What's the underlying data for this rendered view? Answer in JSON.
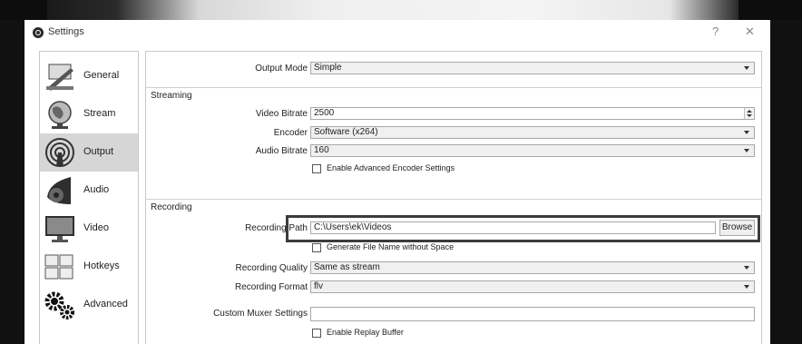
{
  "window": {
    "title": "Settings",
    "help_glyph": "?",
    "close_glyph": "✕"
  },
  "sidebar": {
    "items": [
      {
        "label": "General",
        "icon": "general-icon"
      },
      {
        "label": "Stream",
        "icon": "globe-icon"
      },
      {
        "label": "Output",
        "icon": "output-icon",
        "active": true
      },
      {
        "label": "Audio",
        "icon": "speaker-icon"
      },
      {
        "label": "Video",
        "icon": "monitor-icon"
      },
      {
        "label": "Hotkeys",
        "icon": "keyboard-icon"
      },
      {
        "label": "Advanced",
        "icon": "gears-icon"
      }
    ]
  },
  "output": {
    "output_mode_label": "Output Mode",
    "output_mode_value": "Simple",
    "streaming": {
      "title": "Streaming",
      "video_bitrate_label": "Video Bitrate",
      "video_bitrate_value": "2500",
      "encoder_label": "Encoder",
      "encoder_value": "Software (x264)",
      "audio_bitrate_label": "Audio Bitrate",
      "audio_bitrate_value": "160",
      "advanced_encoder_label": "Enable Advanced Encoder Settings"
    },
    "recording": {
      "title": "Recording",
      "path_label": "Recording Path",
      "path_value": "C:\\Users\\ek\\Videos",
      "browse_label": "Browse",
      "generate_filename_label": "Generate File Name without Space",
      "quality_label": "Recording Quality",
      "quality_value": "Same as stream",
      "format_label": "Recording Format",
      "format_value": "flv",
      "muxer_label": "Custom Muxer Settings",
      "muxer_value": "",
      "replay_buffer_label": "Enable Replay Buffer"
    }
  }
}
